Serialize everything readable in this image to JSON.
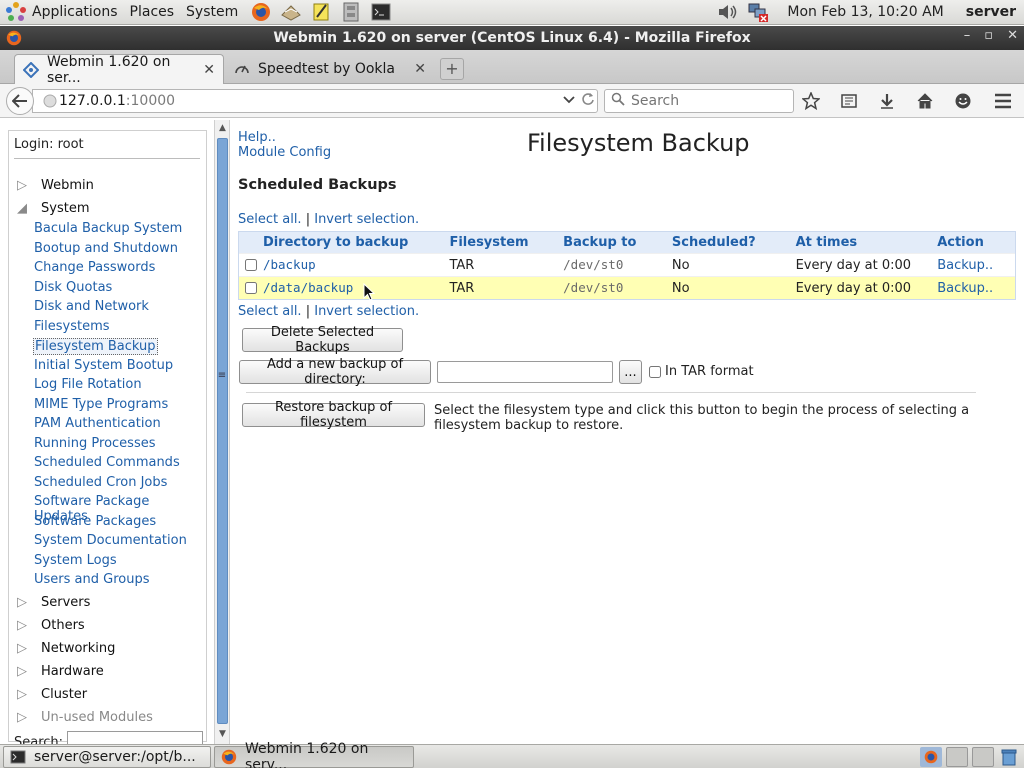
{
  "panel": {
    "applications": "Applications",
    "places": "Places",
    "system": "System",
    "clock": "Mon Feb 13, 10:20 AM",
    "hostname": "server"
  },
  "window": {
    "title": "Webmin 1.620 on server (CentOS Linux 6.4) - Mozilla Firefox"
  },
  "tabs": [
    {
      "label": "Webmin 1.620 on ser...",
      "active": true
    },
    {
      "label": "Speedtest by Ookla",
      "active": false
    }
  ],
  "navbar": {
    "url_host": "127.0.0.1",
    "url_port": ":10000",
    "search_placeholder": "Search"
  },
  "sidebar": {
    "login": "Login: root",
    "categories_top": [
      {
        "label": "Webmin",
        "expanded": false
      },
      {
        "label": "System",
        "expanded": true
      }
    ],
    "modules": [
      "Bacula Backup System",
      "Bootup and Shutdown",
      "Change Passwords",
      "Disk Quotas",
      "Disk and Network",
      "Filesystems",
      "Filesystem Backup",
      "Initial System Bootup",
      "Log File Rotation",
      "MIME Type Programs",
      "PAM Authentication",
      "Running Processes",
      "Scheduled Commands",
      "Scheduled Cron Jobs",
      "Software Package Updates",
      "Software Packages",
      "System Documentation",
      "System Logs",
      "Users and Groups"
    ],
    "active_module": "Filesystem Backup",
    "categories_bottom": [
      "Servers",
      "Others",
      "Networking",
      "Hardware",
      "Cluster",
      "Un-used Modules"
    ],
    "search_label": "Search:"
  },
  "main": {
    "help": "Help..",
    "module_config": "Module Config",
    "title": "Filesystem Backup",
    "section": "Scheduled Backups",
    "select_all": "Select all.",
    "separator": "|",
    "invert": "Invert selection.",
    "table": {
      "headers": [
        "Directory to backup",
        "Filesystem",
        "Backup to",
        "Scheduled?",
        "At times",
        "Action"
      ],
      "rows": [
        {
          "dir": "/backup",
          "fs": "TAR",
          "to": "/dev/st0",
          "scheduled": "No",
          "times": "Every day at 0:00",
          "action": "Backup..",
          "highlighted": false
        },
        {
          "dir": "/data/backup",
          "fs": "TAR",
          "to": "/dev/st0",
          "scheduled": "No",
          "times": "Every day at 0:00",
          "action": "Backup..",
          "highlighted": true
        }
      ]
    },
    "delete_button": "Delete Selected Backups",
    "add_button": "Add a new backup of directory:",
    "browse_button": "...",
    "tar_label": "In TAR format",
    "restore_button": "Restore backup of filesystem",
    "restore_desc": "Select the filesystem type and click this button to begin the process of selecting a filesystem backup to restore."
  },
  "taskbar": {
    "items": [
      {
        "label": "server@server:/opt/b...",
        "active": false
      },
      {
        "label": "Webmin 1.620 on serv...",
        "active": true
      }
    ]
  }
}
